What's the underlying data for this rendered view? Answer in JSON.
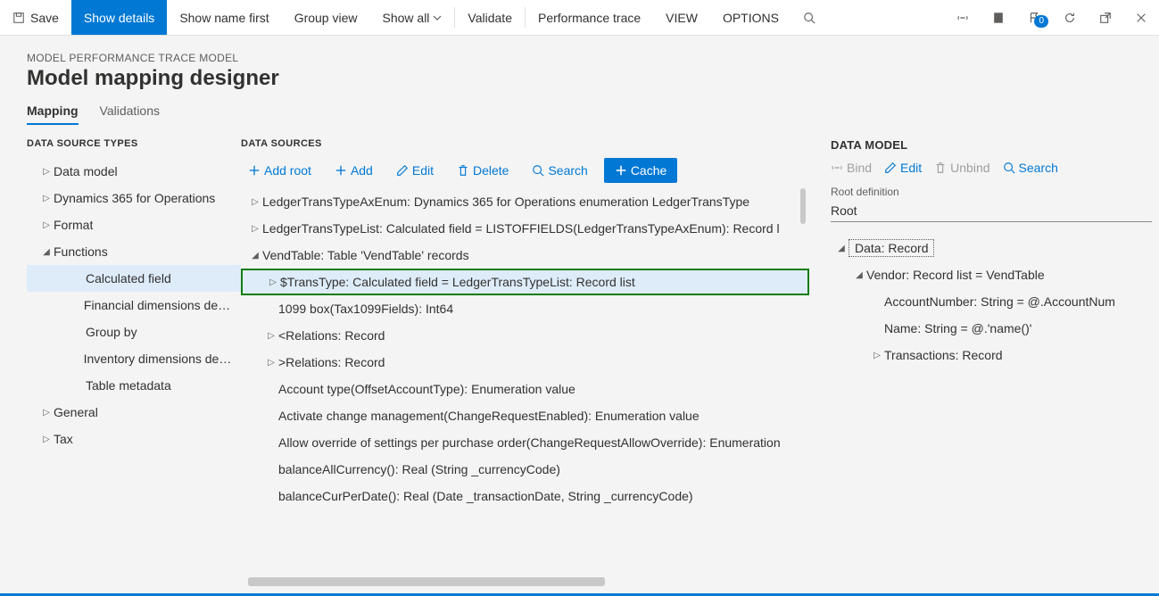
{
  "toolbar": {
    "save": "Save",
    "show_details": "Show details",
    "show_name_first": "Show name first",
    "group_view": "Group view",
    "show_all": "Show all",
    "validate": "Validate",
    "perf_trace": "Performance trace",
    "view": "VIEW",
    "options": "OPTIONS",
    "notif_count": "0"
  },
  "header": {
    "breadcrumb": "MODEL PERFORMANCE TRACE MODEL",
    "title": "Model mapping designer"
  },
  "tabs": {
    "mapping": "Mapping",
    "validations": "Validations"
  },
  "dstypes": {
    "heading": "DATA SOURCE TYPES",
    "items": [
      {
        "label": "Data model",
        "expanded": false,
        "level": 0
      },
      {
        "label": "Dynamics 365 for Operations",
        "expanded": false,
        "level": 0
      },
      {
        "label": "Format",
        "expanded": false,
        "level": 0
      },
      {
        "label": "Functions",
        "expanded": true,
        "level": 0
      },
      {
        "label": "Calculated field",
        "level": 1,
        "selected": true
      },
      {
        "label": "Financial dimensions details",
        "level": 1
      },
      {
        "label": "Group by",
        "level": 1
      },
      {
        "label": "Inventory dimensions details",
        "level": 1
      },
      {
        "label": "Table metadata",
        "level": 1
      },
      {
        "label": "General",
        "expanded": false,
        "level": 0
      },
      {
        "label": "Tax",
        "expanded": false,
        "level": 0
      }
    ]
  },
  "datasources": {
    "heading": "DATA SOURCES",
    "toolbar": {
      "add_root": "Add root",
      "add": "Add",
      "edit": "Edit",
      "delete": "Delete",
      "search": "Search",
      "cache": "Cache"
    },
    "items": [
      {
        "label": "LedgerTransTypeAxEnum: Dynamics 365 for Operations enumeration LedgerTransType",
        "level": 0,
        "twist": "r"
      },
      {
        "label": "LedgerTransTypeList: Calculated field = LISTOFFIELDS(LedgerTransTypeAxEnum): Record l",
        "level": 0,
        "twist": "r"
      },
      {
        "label": "VendTable: Table 'VendTable' records",
        "level": 0,
        "twist": "d"
      },
      {
        "label": "$TransType: Calculated field = LedgerTransTypeList: Record list",
        "level": 1,
        "twist": "r",
        "selected": true,
        "highlight": true
      },
      {
        "label": "1099 box(Tax1099Fields): Int64",
        "level": 1,
        "twist": ""
      },
      {
        "label": "<Relations: Record",
        "level": 1,
        "twist": "r"
      },
      {
        "label": ">Relations: Record",
        "level": 1,
        "twist": "r"
      },
      {
        "label": "Account type(OffsetAccountType): Enumeration value",
        "level": 1,
        "twist": ""
      },
      {
        "label": "Activate change management(ChangeRequestEnabled): Enumeration value",
        "level": 1,
        "twist": ""
      },
      {
        "label": "Allow override of settings per purchase order(ChangeRequestAllowOverride): Enumeration",
        "level": 1,
        "twist": ""
      },
      {
        "label": "balanceAllCurrency(): Real (String _currencyCode)",
        "level": 1,
        "twist": ""
      },
      {
        "label": "balanceCurPerDate(): Real (Date _transactionDate, String _currencyCode)",
        "level": 1,
        "twist": ""
      }
    ]
  },
  "datamodel": {
    "heading": "DATA MODEL",
    "toolbar": {
      "bind": "Bind",
      "edit": "Edit",
      "unbind": "Unbind",
      "search": "Search"
    },
    "rootdef_label": "Root definition",
    "rootdef_value": "Root",
    "items": [
      {
        "label": "Data: Record",
        "level": 0,
        "twist": "d",
        "dotted": true
      },
      {
        "label": "Vendor: Record list = VendTable",
        "level": 1,
        "twist": "d"
      },
      {
        "label": "AccountNumber: String = @.AccountNum",
        "level": 2,
        "twist": ""
      },
      {
        "label": "Name: String = @.'name()'",
        "level": 2,
        "twist": ""
      },
      {
        "label": "Transactions: Record",
        "level": 2,
        "twist": "r"
      }
    ]
  }
}
